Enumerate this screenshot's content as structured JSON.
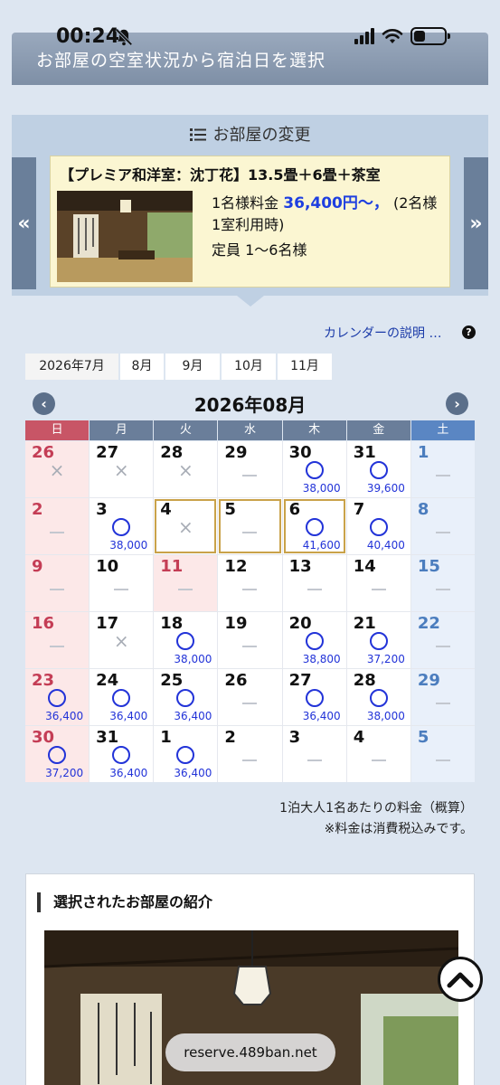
{
  "status_bar": {
    "time": "00:24"
  },
  "header": {
    "title": "お部屋の空室状況から宿泊日を選択"
  },
  "room_change": {
    "title": "お部屋の変更",
    "prev_label": "«",
    "next_label": "»",
    "room": {
      "name": "【プレミア和洋室：沈丁花】13.5畳＋6畳＋茶室",
      "price_prefix": "1名様料金",
      "price_amount": "36,400円～，",
      "price_suffix": "(2名様1室利用時)",
      "capacity": "定員 1～6名様"
    }
  },
  "calendar_help": {
    "label": "カレンダーの説明 …",
    "icon": "?"
  },
  "month_tabs": [
    "2026年7月",
    "8月",
    "9月",
    "10月",
    "11月"
  ],
  "calendar": {
    "title": "2026年08月",
    "prev_icon": "‹",
    "next_icon": "›",
    "weekdays": [
      "日",
      "月",
      "火",
      "水",
      "木",
      "金",
      "土"
    ],
    "weeks": [
      [
        {
          "day": "26",
          "mark": "cross"
        },
        {
          "day": "27",
          "mark": "cross"
        },
        {
          "day": "28",
          "mark": "cross"
        },
        {
          "day": "29",
          "mark": "dash"
        },
        {
          "day": "30",
          "mark": "circle",
          "price": "38,000"
        },
        {
          "day": "31",
          "mark": "circle",
          "price": "39,600"
        },
        {
          "day": "1",
          "mark": "dash"
        }
      ],
      [
        {
          "day": "2",
          "mark": "dash"
        },
        {
          "day": "3",
          "mark": "circle",
          "price": "38,000"
        },
        {
          "day": "4",
          "mark": "cross",
          "selected": true
        },
        {
          "day": "5",
          "mark": "dash",
          "selected": true
        },
        {
          "day": "6",
          "mark": "circle",
          "price": "41,600",
          "selected": true
        },
        {
          "day": "7",
          "mark": "circle",
          "price": "40,400"
        },
        {
          "day": "8",
          "mark": "dash"
        }
      ],
      [
        {
          "day": "9",
          "mark": "dash"
        },
        {
          "day": "10",
          "mark": "dash"
        },
        {
          "day": "11",
          "mark": "dash",
          "holiday": true
        },
        {
          "day": "12",
          "mark": "dash"
        },
        {
          "day": "13",
          "mark": "dash"
        },
        {
          "day": "14",
          "mark": "dash"
        },
        {
          "day": "15",
          "mark": "dash"
        }
      ],
      [
        {
          "day": "16",
          "mark": "dash"
        },
        {
          "day": "17",
          "mark": "cross"
        },
        {
          "day": "18",
          "mark": "circle",
          "price": "38,000"
        },
        {
          "day": "19",
          "mark": "dash"
        },
        {
          "day": "20",
          "mark": "circle",
          "price": "38,800"
        },
        {
          "day": "21",
          "mark": "circle",
          "price": "37,200"
        },
        {
          "day": "22",
          "mark": "dash"
        }
      ],
      [
        {
          "day": "23",
          "mark": "circle",
          "price": "36,400"
        },
        {
          "day": "24",
          "mark": "circle",
          "price": "36,400"
        },
        {
          "day": "25",
          "mark": "circle",
          "price": "36,400"
        },
        {
          "day": "26",
          "mark": "dash"
        },
        {
          "day": "27",
          "mark": "circle",
          "price": "36,400"
        },
        {
          "day": "28",
          "mark": "circle",
          "price": "38,000"
        },
        {
          "day": "29",
          "mark": "dash"
        }
      ],
      [
        {
          "day": "30",
          "mark": "circle",
          "price": "37,200"
        },
        {
          "day": "31",
          "mark": "circle",
          "price": "36,400"
        },
        {
          "day": "1",
          "mark": "circle",
          "price": "36,400"
        },
        {
          "day": "2",
          "mark": "dash"
        },
        {
          "day": "3",
          "mark": "dash"
        },
        {
          "day": "4",
          "mark": "dash"
        },
        {
          "day": "5",
          "mark": "dash"
        }
      ]
    ]
  },
  "notes": {
    "line1": "1泊大人1名あたりの料金（概算）",
    "line2": "※料金は消費税込みです。"
  },
  "intro": {
    "title": "選択されたお部屋の紹介"
  },
  "browser": {
    "url": "reserve.489ban.net"
  },
  "colors": {
    "accent_blue": "#1e3fe0",
    "selected_border": "#c9a24a",
    "sunday": "#c43d55",
    "saturday": "#4b7dbe"
  }
}
